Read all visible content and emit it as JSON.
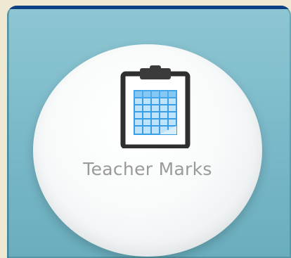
{
  "tile": {
    "label": "Teacher Marks",
    "icon": "clipboard-grid-icon"
  },
  "colors": {
    "page_background": "#efe9d3",
    "tile_background": "#79b8c8",
    "tile_topbar": "#0c3f84",
    "circle_background": "#f9fbfb",
    "label_text": "#9a9a9a",
    "icon_grid": "#3aa0e6"
  }
}
